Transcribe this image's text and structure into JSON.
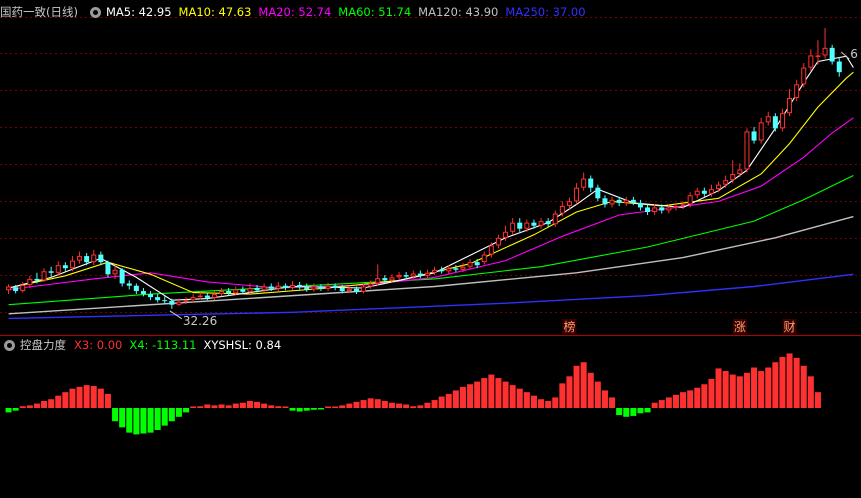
{
  "main_panel": {
    "title": "国药一致(日线)",
    "ma_labels": [
      {
        "text": "MA5: 42.95",
        "color": "#ffffff"
      },
      {
        "text": "MA10: 47.63",
        "color": "#ffff00"
      },
      {
        "text": "MA20: 52.74",
        "color": "#ff00ff"
      },
      {
        "text": "MA60: 51.74",
        "color": "#00ff00"
      },
      {
        "text": "MA120: 43.90",
        "color": "#c0c0c0"
      },
      {
        "text": "MA250: 37.00",
        "color": "#3030ff"
      }
    ],
    "low_label": "32.26",
    "high_label": "6",
    "event_markers": [
      {
        "text": "榜",
        "day": 79
      },
      {
        "text": "涨",
        "day": 103
      },
      {
        "text": "财",
        "day": 110
      }
    ]
  },
  "sub_panel": {
    "title": "控盘力度",
    "labels": [
      {
        "text": "X3: 0.00",
        "color": "#ff3030"
      },
      {
        "text": "X4: -113.11",
        "color": "#00ff00"
      },
      {
        "text": "XYSHSL: 0.84",
        "color": "#ffffff"
      }
    ]
  },
  "colors": {
    "up": "#ff3030",
    "down": "#54ffff",
    "grid": "#7a0000",
    "ma5": "#ffffff",
    "ma10": "#ffff00",
    "ma20": "#ff00ff",
    "ma60": "#00ff00",
    "ma120": "#c0c0c0",
    "ma250": "#3030ff"
  },
  "chart_data": [
    {
      "type": "candlestick",
      "title": "国药一致(日线)",
      "ylim": [
        30,
        70
      ],
      "candles": [
        [
          34.7,
          35.2,
          34.2,
          35.5
        ],
        [
          35.1,
          34.6,
          34.3,
          35.4
        ],
        [
          34.6,
          35.4,
          34.4,
          35.8
        ],
        [
          35.4,
          36.2,
          35.0,
          36.6
        ],
        [
          36.2,
          36.0,
          35.6,
          37.0
        ],
        [
          36.0,
          37.2,
          35.8,
          37.6
        ],
        [
          37.2,
          37.0,
          36.5,
          37.8
        ],
        [
          37.0,
          38.0,
          36.6,
          38.5
        ],
        [
          38.0,
          37.6,
          37.2,
          38.4
        ],
        [
          37.6,
          38.6,
          37.2,
          39.2
        ],
        [
          38.6,
          39.2,
          38.2,
          39.8
        ],
        [
          39.2,
          38.4,
          38.0,
          39.6
        ],
        [
          38.4,
          39.4,
          38.0,
          40.0
        ],
        [
          39.4,
          38.4,
          38.0,
          39.8
        ],
        [
          38.4,
          36.8,
          36.4,
          38.6
        ],
        [
          36.8,
          37.4,
          36.2,
          37.9
        ],
        [
          37.4,
          35.6,
          35.2,
          37.6
        ],
        [
          35.6,
          35.3,
          34.8,
          36.0
        ],
        [
          35.3,
          34.6,
          34.2,
          35.6
        ],
        [
          34.6,
          34.2,
          33.9,
          35.0
        ],
        [
          34.2,
          33.8,
          33.4,
          34.6
        ],
        [
          33.8,
          33.4,
          33.1,
          34.2
        ],
        [
          33.4,
          33.3,
          32.9,
          33.9
        ],
        [
          33.3,
          32.8,
          32.26,
          33.6
        ],
        [
          32.8,
          33.2,
          32.6,
          33.6
        ],
        [
          33.2,
          33.4,
          32.9,
          33.8
        ],
        [
          33.4,
          33.8,
          33.1,
          34.2
        ],
        [
          33.8,
          34.0,
          33.5,
          34.5
        ],
        [
          34.0,
          33.7,
          33.4,
          34.4
        ],
        [
          33.7,
          34.2,
          33.4,
          34.6
        ],
        [
          34.2,
          34.6,
          33.9,
          35.0
        ],
        [
          34.6,
          34.3,
          34.0,
          35.0
        ],
        [
          34.3,
          34.8,
          34.0,
          35.2
        ],
        [
          34.8,
          34.5,
          34.2,
          35.2
        ],
        [
          34.5,
          35.0,
          34.2,
          35.6
        ],
        [
          35.0,
          34.7,
          34.4,
          35.4
        ],
        [
          34.7,
          35.2,
          34.4,
          35.6
        ],
        [
          35.2,
          34.9,
          34.6,
          35.6
        ],
        [
          34.9,
          35.3,
          34.6,
          35.8
        ],
        [
          35.3,
          35.0,
          34.7,
          35.6
        ],
        [
          35.0,
          35.4,
          34.7,
          35.9
        ],
        [
          35.4,
          35.1,
          34.8,
          35.8
        ],
        [
          35.1,
          34.8,
          34.5,
          35.6
        ],
        [
          34.8,
          35.2,
          34.5,
          35.6
        ],
        [
          35.2,
          34.9,
          34.6,
          35.5
        ],
        [
          34.9,
          35.3,
          34.6,
          35.7
        ],
        [
          35.3,
          35.0,
          34.7,
          35.6
        ],
        [
          35.0,
          34.6,
          34.3,
          35.4
        ],
        [
          34.6,
          34.9,
          34.3,
          35.3
        ],
        [
          34.9,
          34.5,
          34.2,
          35.2
        ],
        [
          34.5,
          35.2,
          34.3,
          35.6
        ],
        [
          35.2,
          35.6,
          34.9,
          36.0
        ],
        [
          35.6,
          36.3,
          35.3,
          38.1
        ],
        [
          36.3,
          36.0,
          35.6,
          36.7
        ],
        [
          36.0,
          36.4,
          35.7,
          36.8
        ],
        [
          36.4,
          36.7,
          36.1,
          37.1
        ],
        [
          36.7,
          36.5,
          36.2,
          37.1
        ],
        [
          36.5,
          36.9,
          36.2,
          37.3
        ],
        [
          36.9,
          36.6,
          36.3,
          37.3
        ],
        [
          36.6,
          37.0,
          36.3,
          37.4
        ],
        [
          37.0,
          37.4,
          36.7,
          37.8
        ],
        [
          37.4,
          37.2,
          36.9,
          37.8
        ],
        [
          37.2,
          37.6,
          36.9,
          38.0
        ],
        [
          37.6,
          37.4,
          37.1,
          38.0
        ],
        [
          37.4,
          37.8,
          37.1,
          38.3
        ],
        [
          37.8,
          38.4,
          37.5,
          38.8
        ],
        [
          38.4,
          38.0,
          37.6,
          38.8
        ],
        [
          38.4,
          39.4,
          38.1,
          39.8
        ],
        [
          39.4,
          40.6,
          39.0,
          41.0
        ],
        [
          40.6,
          41.6,
          40.2,
          42.0
        ],
        [
          41.6,
          42.4,
          41.2,
          43.2
        ],
        [
          42.4,
          43.6,
          42.0,
          44.2
        ],
        [
          43.6,
          42.8,
          42.4,
          44.2
        ],
        [
          42.8,
          43.6,
          42.4,
          44.0
        ],
        [
          43.6,
          43.2,
          42.8,
          44.0
        ],
        [
          43.2,
          43.8,
          42.8,
          44.2
        ],
        [
          43.8,
          43.4,
          43.0,
          44.2
        ],
        [
          43.4,
          44.8,
          43.0,
          45.2
        ],
        [
          44.8,
          45.8,
          44.4,
          46.4
        ],
        [
          45.8,
          46.4,
          45.4,
          46.9
        ],
        [
          46.4,
          48.2,
          46.0,
          48.8
        ],
        [
          48.2,
          49.4,
          47.8,
          50.2
        ],
        [
          49.4,
          48.2,
          47.6,
          49.8
        ],
        [
          48.2,
          46.8,
          46.4,
          48.6
        ],
        [
          46.8,
          46.0,
          45.6,
          47.2
        ],
        [
          46.0,
          46.6,
          45.6,
          47.0
        ],
        [
          46.6,
          46.2,
          45.8,
          47.0
        ],
        [
          46.2,
          46.6,
          45.8,
          47.0
        ],
        [
          46.6,
          46.2,
          45.9,
          47.0
        ],
        [
          46.2,
          45.6,
          45.2,
          46.6
        ],
        [
          45.6,
          45.0,
          44.6,
          46.0
        ],
        [
          45.0,
          45.6,
          44.6,
          46.0
        ],
        [
          45.6,
          45.2,
          44.8,
          46.0
        ],
        [
          45.2,
          45.6,
          44.8,
          46.0
        ],
        [
          45.6,
          45.8,
          45.2,
          46.2
        ],
        [
          45.8,
          46.0,
          45.4,
          46.4
        ],
        [
          46.0,
          47.2,
          45.6,
          47.6
        ],
        [
          47.2,
          47.8,
          46.8,
          48.2
        ],
        [
          47.8,
          47.4,
          47.0,
          48.2
        ],
        [
          47.4,
          48.0,
          47.0,
          48.6
        ],
        [
          48.0,
          48.6,
          47.6,
          49.0
        ],
        [
          48.6,
          49.2,
          48.2,
          49.8
        ],
        [
          49.2,
          50.0,
          48.8,
          51.8
        ],
        [
          50.0,
          50.6,
          49.6,
          51.4
        ],
        [
          50.6,
          55.6,
          50.2,
          56.0
        ],
        [
          55.6,
          54.4,
          54.0,
          56.2
        ],
        [
          54.4,
          56.8,
          54.0,
          57.4
        ],
        [
          56.8,
          57.6,
          56.4,
          58.2
        ],
        [
          57.6,
          56.0,
          55.6,
          58.0
        ],
        [
          56.0,
          58.0,
          55.6,
          58.6
        ],
        [
          58.0,
          60.0,
          57.6,
          61.2
        ],
        [
          60.0,
          61.8,
          59.6,
          62.4
        ],
        [
          61.8,
          64.0,
          61.4,
          64.6
        ],
        [
          64.0,
          65.6,
          63.6,
          66.4
        ],
        [
          65.6,
          65.6,
          64.4,
          67.6
        ],
        [
          65.6,
          66.6,
          65.2,
          69.2
        ],
        [
          66.6,
          64.8,
          64.4,
          67.0
        ],
        [
          64.8,
          63.4,
          62.8,
          65.4
        ]
      ],
      "ma": {
        "ma5": [
          [
            0,
            35.0
          ],
          [
            6,
            36.4
          ],
          [
            13,
            38.9
          ],
          [
            18,
            36.4
          ],
          [
            23,
            33.4
          ],
          [
            28,
            33.6
          ],
          [
            40,
            35.2
          ],
          [
            50,
            35.0
          ],
          [
            60,
            37.0
          ],
          [
            70,
            41.6
          ],
          [
            76,
            43.6
          ],
          [
            80,
            46.0
          ],
          [
            83,
            48.0
          ],
          [
            88,
            46.2
          ],
          [
            95,
            45.6
          ],
          [
            100,
            47.8
          ],
          [
            104,
            50.5
          ],
          [
            108,
            56.0
          ],
          [
            112,
            62.0
          ],
          [
            114,
            64.8
          ],
          [
            118,
            65.5
          ],
          [
            119,
            64.0
          ]
        ],
        "ma10": [
          [
            0,
            35.0
          ],
          [
            8,
            36.6
          ],
          [
            14,
            38.4
          ],
          [
            20,
            36.8
          ],
          [
            26,
            34.4
          ],
          [
            34,
            34.2
          ],
          [
            45,
            35.0
          ],
          [
            55,
            36.0
          ],
          [
            65,
            38.2
          ],
          [
            74,
            42.0
          ],
          [
            80,
            45.0
          ],
          [
            85,
            46.4
          ],
          [
            92,
            45.8
          ],
          [
            100,
            46.8
          ],
          [
            106,
            50.0
          ],
          [
            110,
            54.0
          ],
          [
            114,
            58.8
          ],
          [
            118,
            62.6
          ],
          [
            119,
            63.4
          ]
        ],
        "ma20": [
          [
            0,
            34.8
          ],
          [
            12,
            36.2
          ],
          [
            20,
            37.0
          ],
          [
            28,
            35.8
          ],
          [
            38,
            35.0
          ],
          [
            50,
            35.4
          ],
          [
            60,
            36.4
          ],
          [
            70,
            38.6
          ],
          [
            78,
            41.8
          ],
          [
            86,
            44.6
          ],
          [
            94,
            45.6
          ],
          [
            100,
            46.4
          ],
          [
            106,
            48.4
          ],
          [
            112,
            52.2
          ],
          [
            116,
            55.4
          ],
          [
            119,
            57.4
          ]
        ],
        "ma60": [
          [
            0,
            32.8
          ],
          [
            20,
            34.2
          ],
          [
            40,
            35.2
          ],
          [
            60,
            36.2
          ],
          [
            75,
            37.8
          ],
          [
            90,
            40.4
          ],
          [
            105,
            43.8
          ],
          [
            112,
            46.6
          ],
          [
            119,
            49.8
          ]
        ],
        "ma120": [
          [
            0,
            31.6
          ],
          [
            30,
            33.4
          ],
          [
            60,
            35.2
          ],
          [
            80,
            37.0
          ],
          [
            95,
            39.0
          ],
          [
            108,
            41.6
          ],
          [
            119,
            44.4
          ]
        ],
        "ma250": [
          [
            0,
            31.0
          ],
          [
            40,
            31.8
          ],
          [
            70,
            33.0
          ],
          [
            90,
            34.0
          ],
          [
            105,
            35.2
          ],
          [
            119,
            36.8
          ]
        ]
      }
    },
    {
      "type": "bar",
      "title": "控盘力度",
      "ylim": [
        -30,
        70
      ],
      "values": [
        -5,
        -3,
        2,
        3,
        5,
        8,
        10,
        14,
        18,
        22,
        24,
        26,
        25,
        22,
        16,
        -15,
        -22,
        -28,
        -30,
        -29,
        -28,
        -25,
        -20,
        -15,
        -10,
        -5,
        0,
        2,
        4,
        3,
        4,
        3,
        5,
        6,
        8,
        7,
        5,
        3,
        2,
        1,
        -3,
        -4,
        -3,
        -2,
        -1,
        0,
        1,
        3,
        5,
        7,
        9,
        11,
        10,
        8,
        6,
        5,
        4,
        2,
        3,
        6,
        9,
        13,
        16,
        20,
        24,
        27,
        30,
        34,
        38,
        34,
        30,
        26,
        22,
        18,
        14,
        10,
        8,
        12,
        28,
        36,
        48,
        52,
        40,
        30,
        20,
        12,
        -8,
        -10,
        -9,
        -6,
        -5,
        6,
        9,
        12,
        15,
        18,
        20,
        23,
        27,
        33,
        45,
        42,
        38,
        36,
        40,
        46,
        42,
        46,
        52,
        58,
        62,
        57,
        48,
        36,
        18
      ]
    }
  ]
}
